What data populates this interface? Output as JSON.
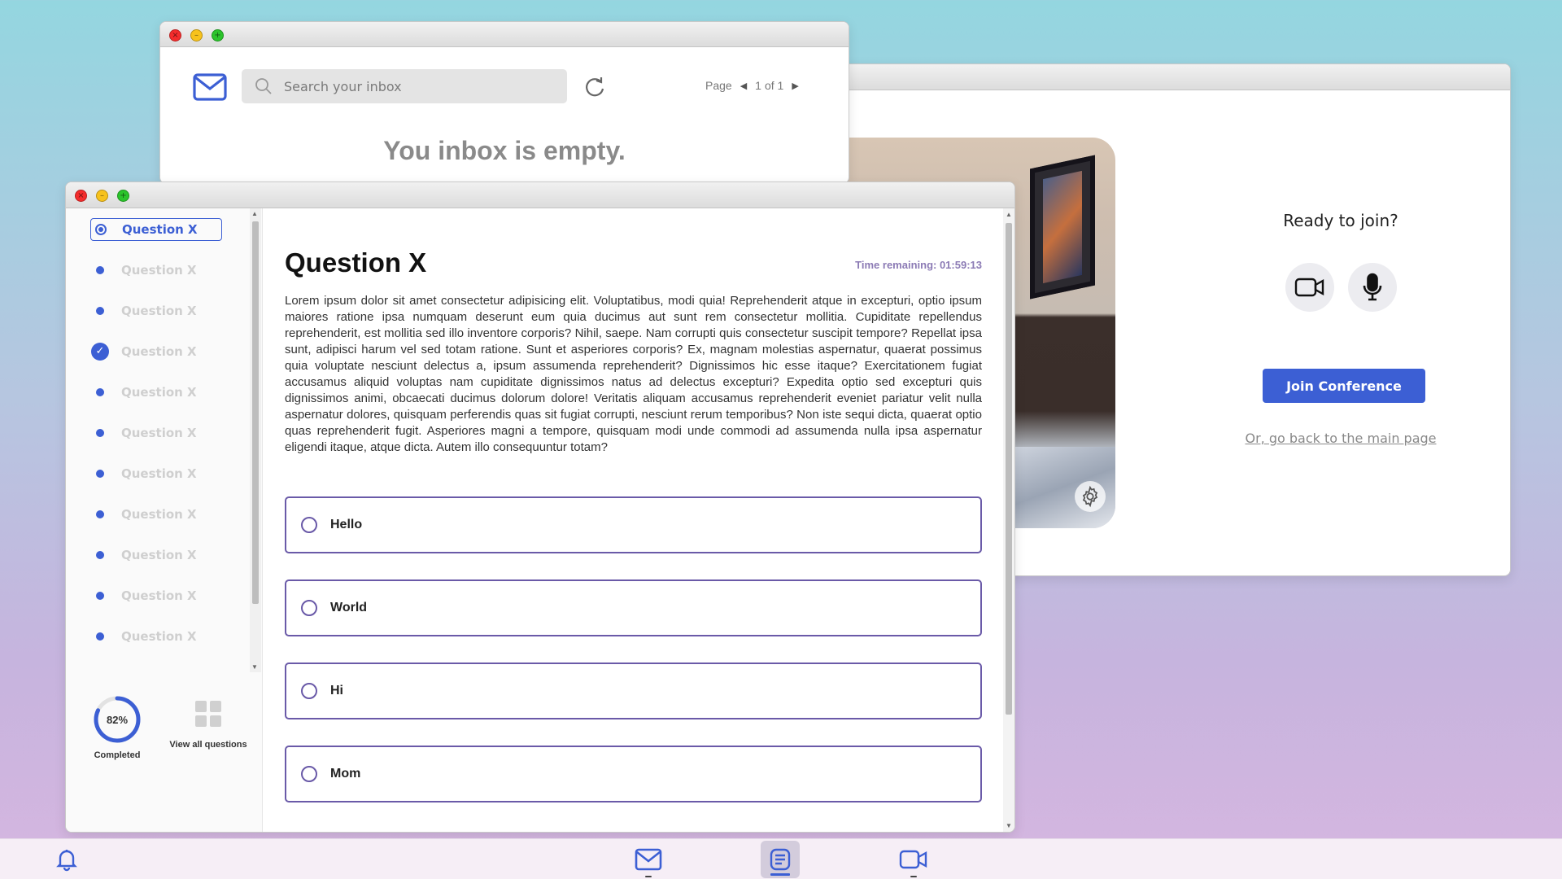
{
  "email": {
    "search_placeholder": "Search your inbox",
    "page_label": "Page",
    "page_current": "1",
    "page_total": "of 1",
    "empty_message": "You inbox is empty."
  },
  "conference": {
    "ready_text": "Ready to join?",
    "join_label": "Join Conference",
    "back_link": "Or, go back to the main page"
  },
  "quiz": {
    "title": "Question X",
    "timer": "Time remaining: 01:59:13",
    "body": "Lorem ipsum dolor sit amet consectetur adipisicing elit. Voluptatibus, modi quia! Reprehenderit atque in excepturi, optio ipsum maiores ratione ipsa numquam deserunt eum quia ducimus aut sunt rem consectetur mollitia. Cupiditate repellendus reprehenderit, est mollitia sed illo inventore corporis? Nihil, saepe. Nam corrupti quis consectetur suscipit tempore? Repellat ipsa sunt, adipisci harum vel sed totam ratione. Sunt et asperiores corporis? Ex, magnam molestias aspernatur, quaerat possimus quia voluptate nesciunt delectus a, ipsum assumenda reprehenderit? Dignissimos hic esse itaque? Exercitationem fugiat accusamus aliquid voluptas nam cupiditate dignissimos natus ad delectus excepturi? Expedita optio sed excepturi quis dignissimos animi, obcaecati ducimus dolorum dolore! Veritatis aliquam accusamus reprehenderit eveniet pariatur velit nulla aspernatur dolores, quisquam perferendis quas sit fugiat corrupti, nesciunt rerum temporibus? Non iste sequi dicta, quaerat optio quas reprehenderit fugit. Asperiores magni a tempore, quisquam modi unde commodi ad assumenda nulla ipsa aspernatur eligendi itaque, atque dicta. Autem illo consequuntur totam?",
    "options": [
      "Hello",
      "World",
      "Hi",
      "Mom"
    ],
    "questions": [
      {
        "label": "Question X",
        "state": "active"
      },
      {
        "label": "Question X",
        "state": "pending"
      },
      {
        "label": "Question X",
        "state": "pending"
      },
      {
        "label": "Question X",
        "state": "done"
      },
      {
        "label": "Question X",
        "state": "pending"
      },
      {
        "label": "Question X",
        "state": "pending"
      },
      {
        "label": "Question X",
        "state": "pending"
      },
      {
        "label": "Question X",
        "state": "pending"
      },
      {
        "label": "Question X",
        "state": "pending"
      },
      {
        "label": "Question X",
        "state": "pending"
      },
      {
        "label": "Question X",
        "state": "pending"
      }
    ],
    "progress_percent": 82,
    "progress_text": "82%",
    "completed_label": "Completed",
    "view_all_label": "View all questions"
  },
  "colors": {
    "accent": "#3c5fd4",
    "option_border": "#6a5aa8",
    "timer": "#8c7bb5"
  },
  "taskbar": {
    "items": [
      "bell-icon",
      "mail-icon",
      "document-icon",
      "video-icon"
    ],
    "active": "document-icon"
  }
}
